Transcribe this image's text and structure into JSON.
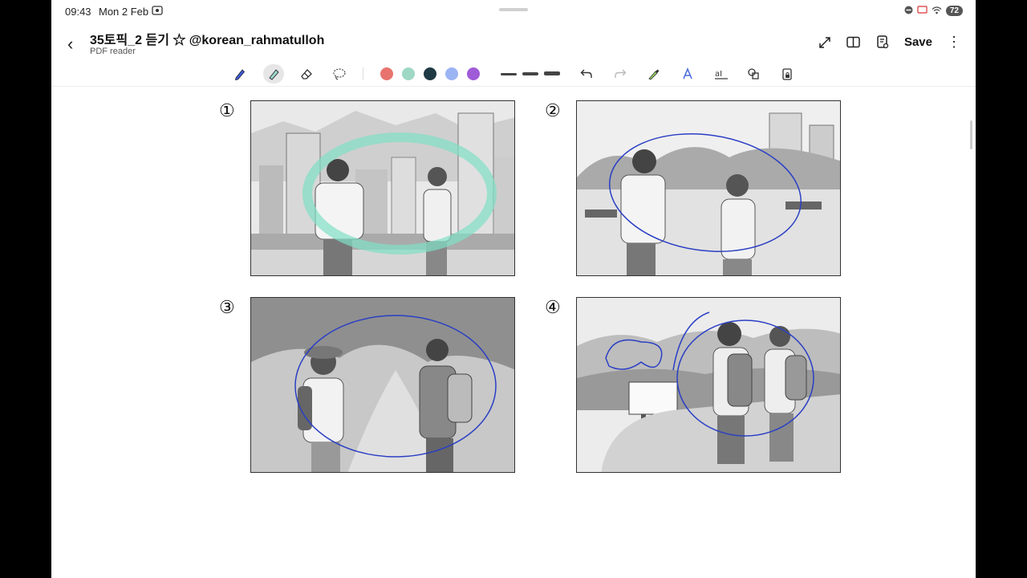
{
  "status": {
    "time": "09:43",
    "date": "Mon 2 Feb",
    "battery": "72"
  },
  "header": {
    "title": "35토픽_2 듣기 ☆ @korean_rahmatulloh",
    "subtitle": "PDF reader",
    "save_label": "Save"
  },
  "toolbar": {
    "tools": [
      "pen-icon",
      "highlighter-icon",
      "eraser-icon",
      "lasso-icon"
    ],
    "colors": [
      "#e8736e",
      "#9fd8c5",
      "#1f3a44",
      "#9bb4f3",
      "#a05bd8"
    ],
    "actions": [
      "undo-icon",
      "redo-icon",
      "color-picker-icon",
      "text-style-icon",
      "text-box-icon",
      "shapes-icon",
      "lock-icon"
    ]
  },
  "page": {
    "numbers": [
      "①",
      "②",
      "③",
      "④"
    ]
  }
}
